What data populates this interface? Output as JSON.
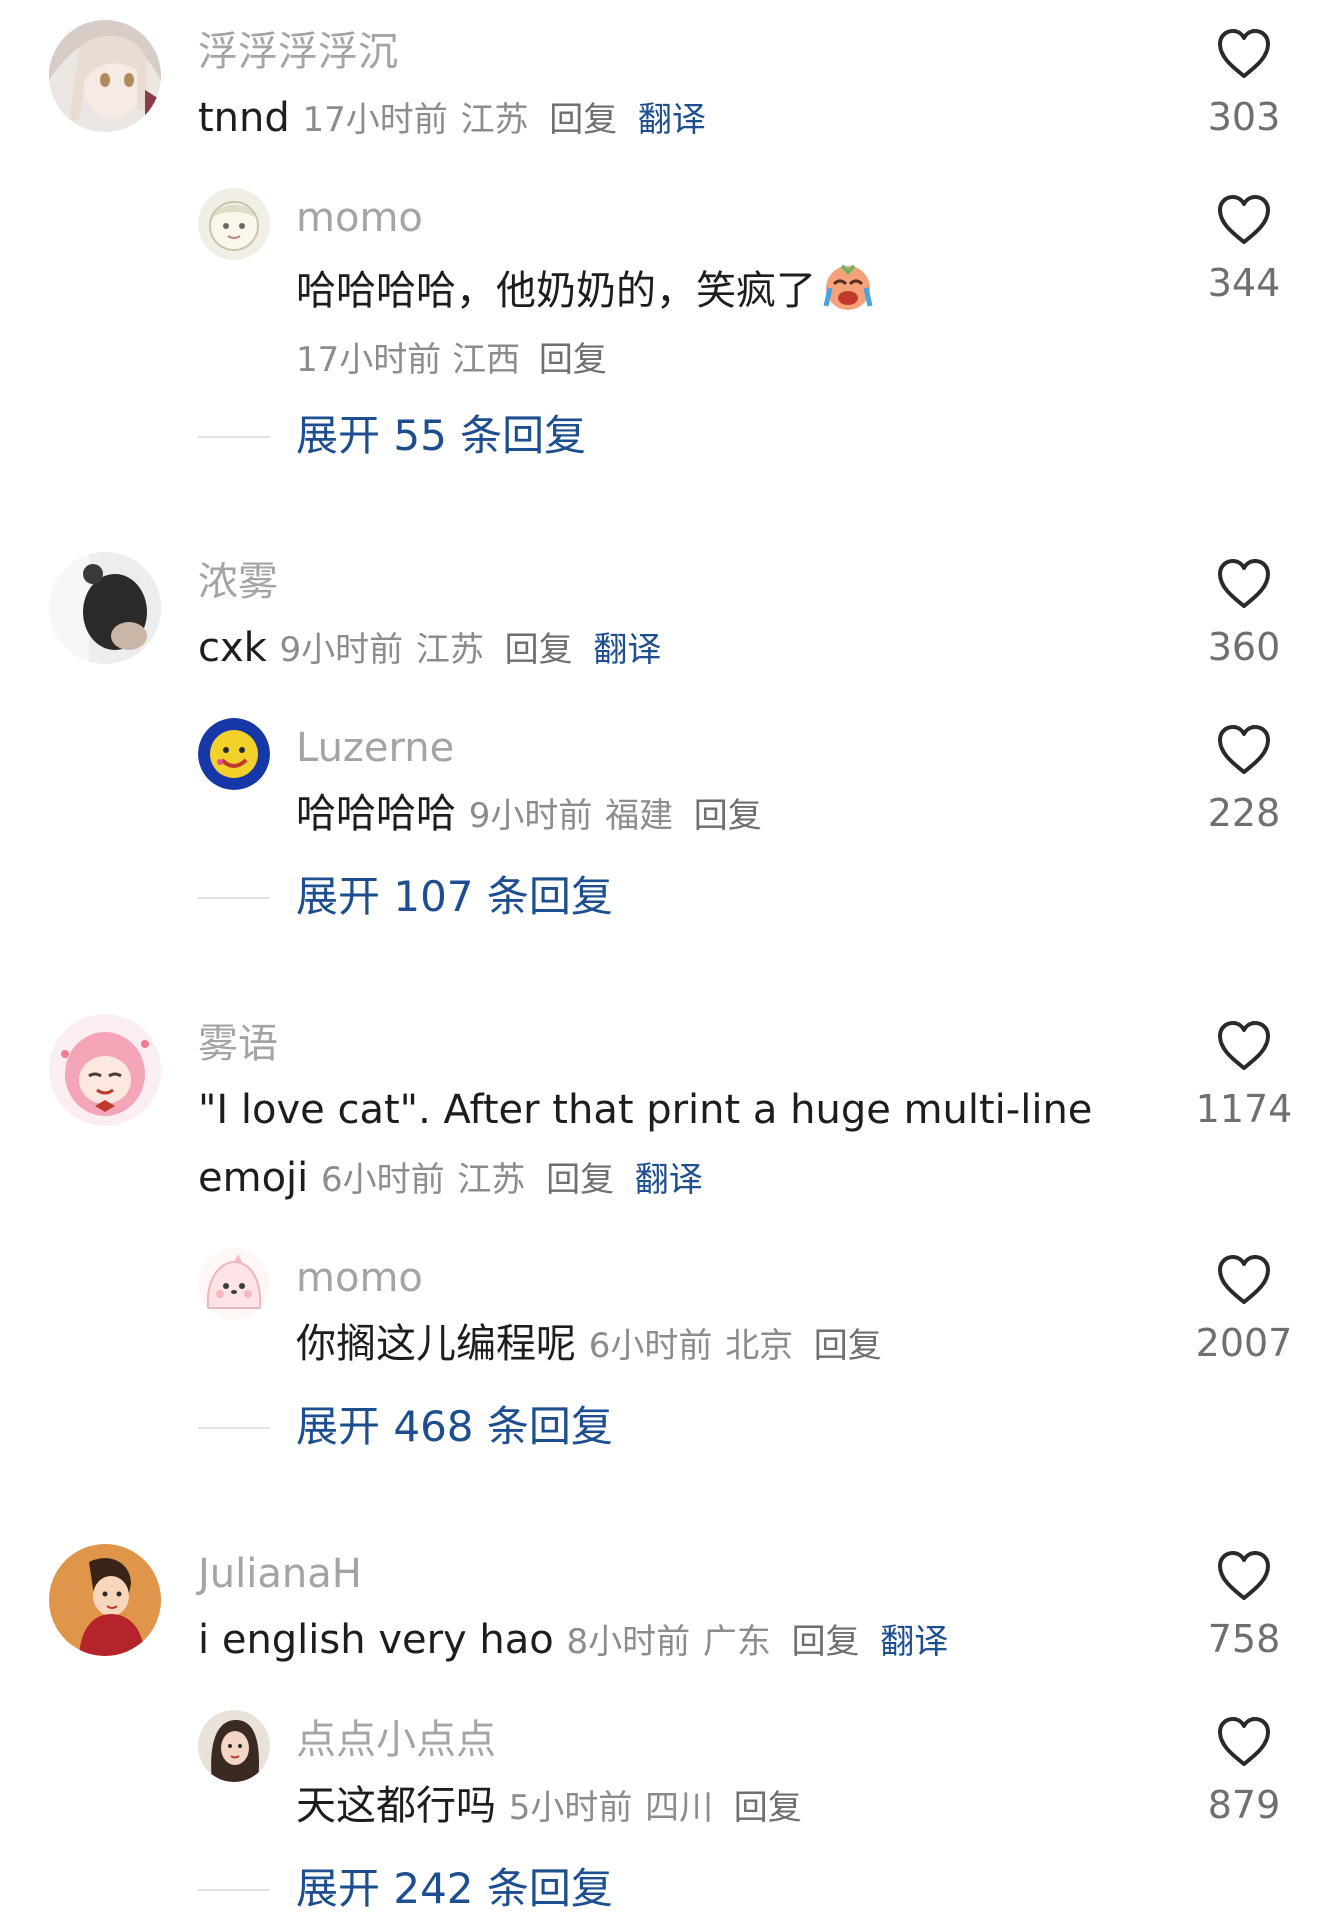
{
  "threads": [
    {
      "comment": {
        "user": "浮浮浮浮沉",
        "text": "tnnd",
        "time": "17小时前",
        "location": "江苏",
        "reply": "回复",
        "translate": "翻译",
        "likes": "303",
        "avatar": "anime-girl-avatar"
      },
      "reply": {
        "user": "momo",
        "text": "哈哈哈哈，他奶奶的，笑疯了",
        "emoji": "crying-laughing-emoji",
        "time": "17小时前",
        "location": "江西",
        "reply": "回复",
        "likes": "344",
        "avatar": "cartoon-avatar"
      },
      "expand": "展开 55 条回复"
    },
    {
      "comment": {
        "user": "浓雾",
        "text": "cxk",
        "time": "9小时前",
        "location": "江苏",
        "reply": "回复",
        "translate": "翻译",
        "likes": "360",
        "avatar": "photo-avatar"
      },
      "reply": {
        "user": "Luzerne",
        "text": "哈哈哈哈",
        "time": "9小时前",
        "location": "福建",
        "reply": "回复",
        "likes": "228",
        "avatar": "smiley-avatar"
      },
      "expand": "展开 107 条回复"
    },
    {
      "comment": {
        "user": "雾语",
        "text_line1": "\"I love cat\". After that print a huge multi-line",
        "text_line2": "emoji",
        "time": "6小时前",
        "location": "江苏",
        "reply": "回复",
        "translate": "翻译",
        "likes": "1174",
        "avatar": "pink-anime-avatar"
      },
      "reply": {
        "user": "momo",
        "text": "你搁这儿编程呢",
        "time": "6小时前",
        "location": "北京",
        "reply": "回复",
        "likes": "2007",
        "avatar": "cute-blob-avatar"
      },
      "expand": "展开 468 条回复"
    },
    {
      "comment": {
        "user": "JulianaH",
        "text": "i english very hao",
        "time": "8小时前",
        "location": "广东",
        "reply": "回复",
        "translate": "翻译",
        "likes": "758",
        "avatar": "cartoon-boy-avatar"
      },
      "reply": {
        "user": "点点小点点",
        "text": "天这都行吗",
        "time": "5小时前",
        "location": "四川",
        "reply": "回复",
        "likes": "879",
        "avatar": "girl-photo-avatar"
      },
      "expand": "展开 242 条回复"
    }
  ],
  "colors": {
    "username": "#a3a3a8",
    "text": "#1d1d1f",
    "meta": "#8b8b90",
    "link": "#1d4e8f"
  }
}
